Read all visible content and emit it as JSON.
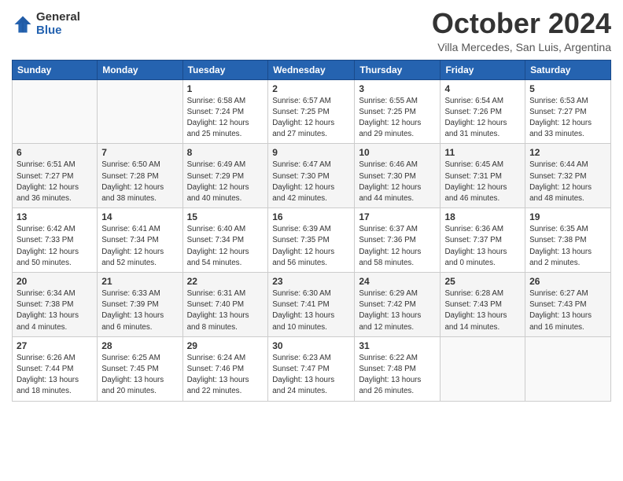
{
  "header": {
    "logo": {
      "general": "General",
      "blue": "Blue"
    },
    "title": "October 2024",
    "subtitle": "Villa Mercedes, San Luis, Argentina"
  },
  "weekdays": [
    "Sunday",
    "Monday",
    "Tuesday",
    "Wednesday",
    "Thursday",
    "Friday",
    "Saturday"
  ],
  "weeks": [
    [
      {
        "day": "",
        "info": ""
      },
      {
        "day": "",
        "info": ""
      },
      {
        "day": "1",
        "info": "Sunrise: 6:58 AM\nSunset: 7:24 PM\nDaylight: 12 hours\nand 25 minutes."
      },
      {
        "day": "2",
        "info": "Sunrise: 6:57 AM\nSunset: 7:25 PM\nDaylight: 12 hours\nand 27 minutes."
      },
      {
        "day": "3",
        "info": "Sunrise: 6:55 AM\nSunset: 7:25 PM\nDaylight: 12 hours\nand 29 minutes."
      },
      {
        "day": "4",
        "info": "Sunrise: 6:54 AM\nSunset: 7:26 PM\nDaylight: 12 hours\nand 31 minutes."
      },
      {
        "day": "5",
        "info": "Sunrise: 6:53 AM\nSunset: 7:27 PM\nDaylight: 12 hours\nand 33 minutes."
      }
    ],
    [
      {
        "day": "6",
        "info": "Sunrise: 6:51 AM\nSunset: 7:27 PM\nDaylight: 12 hours\nand 36 minutes."
      },
      {
        "day": "7",
        "info": "Sunrise: 6:50 AM\nSunset: 7:28 PM\nDaylight: 12 hours\nand 38 minutes."
      },
      {
        "day": "8",
        "info": "Sunrise: 6:49 AM\nSunset: 7:29 PM\nDaylight: 12 hours\nand 40 minutes."
      },
      {
        "day": "9",
        "info": "Sunrise: 6:47 AM\nSunset: 7:30 PM\nDaylight: 12 hours\nand 42 minutes."
      },
      {
        "day": "10",
        "info": "Sunrise: 6:46 AM\nSunset: 7:30 PM\nDaylight: 12 hours\nand 44 minutes."
      },
      {
        "day": "11",
        "info": "Sunrise: 6:45 AM\nSunset: 7:31 PM\nDaylight: 12 hours\nand 46 minutes."
      },
      {
        "day": "12",
        "info": "Sunrise: 6:44 AM\nSunset: 7:32 PM\nDaylight: 12 hours\nand 48 minutes."
      }
    ],
    [
      {
        "day": "13",
        "info": "Sunrise: 6:42 AM\nSunset: 7:33 PM\nDaylight: 12 hours\nand 50 minutes."
      },
      {
        "day": "14",
        "info": "Sunrise: 6:41 AM\nSunset: 7:34 PM\nDaylight: 12 hours\nand 52 minutes."
      },
      {
        "day": "15",
        "info": "Sunrise: 6:40 AM\nSunset: 7:34 PM\nDaylight: 12 hours\nand 54 minutes."
      },
      {
        "day": "16",
        "info": "Sunrise: 6:39 AM\nSunset: 7:35 PM\nDaylight: 12 hours\nand 56 minutes."
      },
      {
        "day": "17",
        "info": "Sunrise: 6:37 AM\nSunset: 7:36 PM\nDaylight: 12 hours\nand 58 minutes."
      },
      {
        "day": "18",
        "info": "Sunrise: 6:36 AM\nSunset: 7:37 PM\nDaylight: 13 hours\nand 0 minutes."
      },
      {
        "day": "19",
        "info": "Sunrise: 6:35 AM\nSunset: 7:38 PM\nDaylight: 13 hours\nand 2 minutes."
      }
    ],
    [
      {
        "day": "20",
        "info": "Sunrise: 6:34 AM\nSunset: 7:38 PM\nDaylight: 13 hours\nand 4 minutes."
      },
      {
        "day": "21",
        "info": "Sunrise: 6:33 AM\nSunset: 7:39 PM\nDaylight: 13 hours\nand 6 minutes."
      },
      {
        "day": "22",
        "info": "Sunrise: 6:31 AM\nSunset: 7:40 PM\nDaylight: 13 hours\nand 8 minutes."
      },
      {
        "day": "23",
        "info": "Sunrise: 6:30 AM\nSunset: 7:41 PM\nDaylight: 13 hours\nand 10 minutes."
      },
      {
        "day": "24",
        "info": "Sunrise: 6:29 AM\nSunset: 7:42 PM\nDaylight: 13 hours\nand 12 minutes."
      },
      {
        "day": "25",
        "info": "Sunrise: 6:28 AM\nSunset: 7:43 PM\nDaylight: 13 hours\nand 14 minutes."
      },
      {
        "day": "26",
        "info": "Sunrise: 6:27 AM\nSunset: 7:43 PM\nDaylight: 13 hours\nand 16 minutes."
      }
    ],
    [
      {
        "day": "27",
        "info": "Sunrise: 6:26 AM\nSunset: 7:44 PM\nDaylight: 13 hours\nand 18 minutes."
      },
      {
        "day": "28",
        "info": "Sunrise: 6:25 AM\nSunset: 7:45 PM\nDaylight: 13 hours\nand 20 minutes."
      },
      {
        "day": "29",
        "info": "Sunrise: 6:24 AM\nSunset: 7:46 PM\nDaylight: 13 hours\nand 22 minutes."
      },
      {
        "day": "30",
        "info": "Sunrise: 6:23 AM\nSunset: 7:47 PM\nDaylight: 13 hours\nand 24 minutes."
      },
      {
        "day": "31",
        "info": "Sunrise: 6:22 AM\nSunset: 7:48 PM\nDaylight: 13 hours\nand 26 minutes."
      },
      {
        "day": "",
        "info": ""
      },
      {
        "day": "",
        "info": ""
      }
    ]
  ]
}
